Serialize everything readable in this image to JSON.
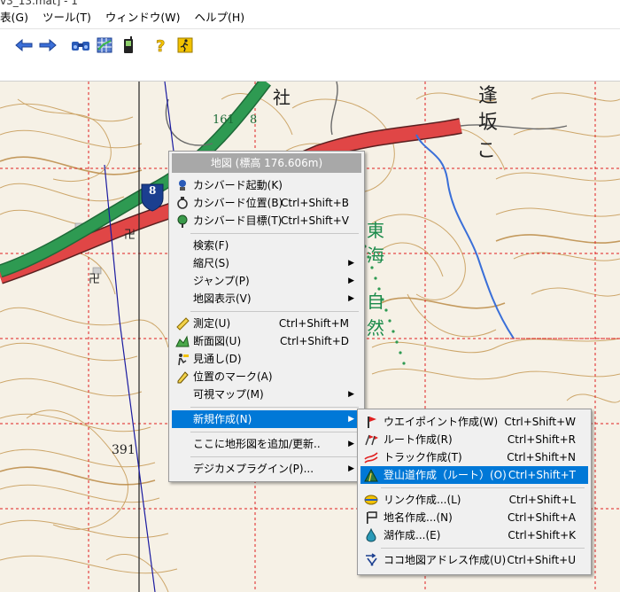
{
  "window": {
    "title_fragment": "v3_13.mat] - 1"
  },
  "menu_bar": [
    "表(G)",
    "ツール(T)",
    "ウィンドウ(W)",
    "ヘルプ(H)"
  ],
  "toolbar_icons": [
    "arrow-left-icon",
    "arrow-right-icon",
    "binoculars-icon",
    "grid-map-icon",
    "gps-device-icon",
    "help-question-icon",
    "runner-icon"
  ],
  "map": {
    "labels": {
      "shrine": "社",
      "route_number": "161",
      "route_shield": "8",
      "elevation_mark": "8",
      "temple_1": "卍",
      "temple_2": "卍",
      "slope_1": "逢",
      "slope_2": "坂",
      "trail_1": "東",
      "trail_2": "海",
      "trail_3": "自",
      "trail_4": "然",
      "spot_height": "391",
      "kana": "こ"
    }
  },
  "context_menu": {
    "header": "地図 (標高 176.606m)",
    "items": [
      {
        "icon": "kashimir-start-icon",
        "label": "カシバード起動(K)",
        "shortcut": ""
      },
      {
        "icon": "kashimir-position-icon",
        "label": "カシバード位置(B)",
        "shortcut": "Ctrl+Shift+B"
      },
      {
        "icon": "kashimir-target-icon",
        "label": "カシバード目標(T)",
        "shortcut": "Ctrl+Shift+V"
      },
      {
        "label": "検索(F)",
        "shortcut": ""
      },
      {
        "label": "縮尺(S)",
        "shortcut": "",
        "submenu": true
      },
      {
        "label": "ジャンプ(P)",
        "shortcut": "",
        "submenu": true
      },
      {
        "label": "地図表示(V)",
        "shortcut": "",
        "submenu": true
      },
      {
        "icon": "ruler-icon",
        "label": "測定(U)",
        "shortcut": "Ctrl+Shift+M"
      },
      {
        "icon": "profile-icon",
        "label": "断面図(U)",
        "shortcut": "Ctrl+Shift+D"
      },
      {
        "icon": "lookout-icon",
        "label": "見通し(D)",
        "shortcut": ""
      },
      {
        "icon": "pencil-icon",
        "label": "位置のマーク(A)",
        "shortcut": ""
      },
      {
        "label": "可視マップ(M)",
        "shortcut": "",
        "submenu": true
      },
      {
        "label": "新規作成(N)",
        "shortcut": "",
        "submenu": true,
        "highlighted": true
      },
      {
        "label": "ここに地形図を追加/更新..",
        "shortcut": "",
        "submenu": true
      },
      {
        "label": "デジカメプラグイン(P)...",
        "shortcut": "",
        "submenu": true
      }
    ]
  },
  "submenu": {
    "items": [
      {
        "icon": "waypoint-flag-icon",
        "label": "ウエイポイント作成(W)",
        "shortcut": "Ctrl+Shift+W"
      },
      {
        "icon": "route-flags-icon",
        "label": "ルート作成(R)",
        "shortcut": "Ctrl+Shift+R"
      },
      {
        "icon": "track-icon",
        "label": "トラック作成(T)",
        "shortcut": "Ctrl+Shift+N"
      },
      {
        "icon": "mountain-trail-icon",
        "label": "登山道作成（ルート）(O)",
        "shortcut": "Ctrl+Shift+T",
        "highlighted": true
      },
      {
        "icon": "link-globe-icon",
        "label": "リンク作成...(L)",
        "shortcut": "Ctrl+Shift+L"
      },
      {
        "icon": "place-name-flag-icon",
        "label": "地名作成...(N)",
        "shortcut": "Ctrl+Shift+A"
      },
      {
        "icon": "lake-drop-icon",
        "label": "湖作成...(E)",
        "shortcut": "Ctrl+Shift+K"
      },
      {
        "icon": "address-arrow-icon",
        "label": "ココ地図アドレス作成(U)",
        "shortcut": "Ctrl+Shift+U"
      }
    ]
  },
  "colors": {
    "highlight": "#0078d7",
    "road_green": "#2e9a52",
    "road_red": "#e04646",
    "river_blue": "#3a6fd8",
    "contour": "#c69a55",
    "grid_red": "#e02020"
  }
}
